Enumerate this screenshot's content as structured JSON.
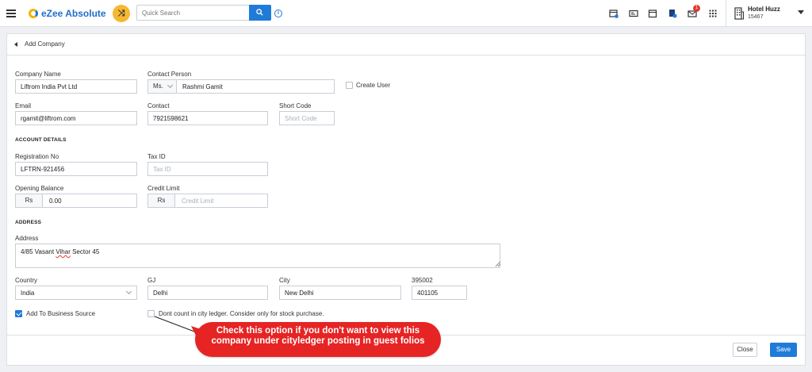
{
  "app": {
    "name": "eZee Absolute"
  },
  "search": {
    "placeholder": "Quick Search"
  },
  "hotel": {
    "name": "Hotel Huzz",
    "id": "15467"
  },
  "notifications": {
    "mail_count": "1"
  },
  "page": {
    "title": "Add Company"
  },
  "form": {
    "company_name": {
      "label": "Company Name",
      "value": "Liftrom India Pvt Ltd"
    },
    "contact_person": {
      "label": "Contact Person",
      "salutation": "Ms.",
      "value": "Rashmi Gamit"
    },
    "create_user": {
      "label": "Create User",
      "checked": false
    },
    "email": {
      "label": "Email",
      "value": "rgamit@liftrom.com"
    },
    "contact": {
      "label": "Contact",
      "value": "7921598621"
    },
    "short_code": {
      "label": "Short Code",
      "placeholder": "Short Code"
    },
    "account_section": "ACCOUNT DETAILS",
    "registration_no": {
      "label": "Registration No",
      "value": "LFTRN-921456"
    },
    "tax_id": {
      "label": "Tax ID",
      "placeholder": "Tax ID"
    },
    "opening_balance": {
      "label": "Opening Balance",
      "currency": "Rs",
      "value": "0.00"
    },
    "credit_limit": {
      "label": "Credit Limit",
      "currency": "Rs",
      "placeholder": "Credit Limit"
    },
    "address_section": "ADDRESS",
    "address": {
      "label": "Address",
      "value_pre": "4/85 Vasant ",
      "value_spell": "Vihar",
      "value_post": " Sector 45"
    },
    "country": {
      "label": "Country",
      "value": "India"
    },
    "state": {
      "label": "GJ",
      "value": "Delhi"
    },
    "city": {
      "label": "City",
      "value": "New Delhi"
    },
    "zip": {
      "label": "395002",
      "value": "401105"
    },
    "add_to_business_source": {
      "label": "Add To Business Source",
      "checked": true
    },
    "dont_count_city_ledger": {
      "label": "Dont count in city ledger. Consider only for stock purchase.",
      "checked": false
    }
  },
  "buttons": {
    "close": "Close",
    "save": "Save"
  },
  "callout": {
    "line1": "Check this option if you don't want to view this",
    "line2": "company under cityledger posting in guest folios"
  },
  "colors": {
    "accent": "#1f7bd8",
    "callout": "#e62424",
    "logo_yellow": "#f7b731"
  },
  "icons": [
    "menu-icon",
    "shuffle-icon",
    "search-icon",
    "info-icon",
    "calendar-check-icon",
    "id-card-icon",
    "calendar-icon",
    "document-icon",
    "mail-icon",
    "apps-grid-icon",
    "building-icon",
    "caret-down-icon"
  ]
}
